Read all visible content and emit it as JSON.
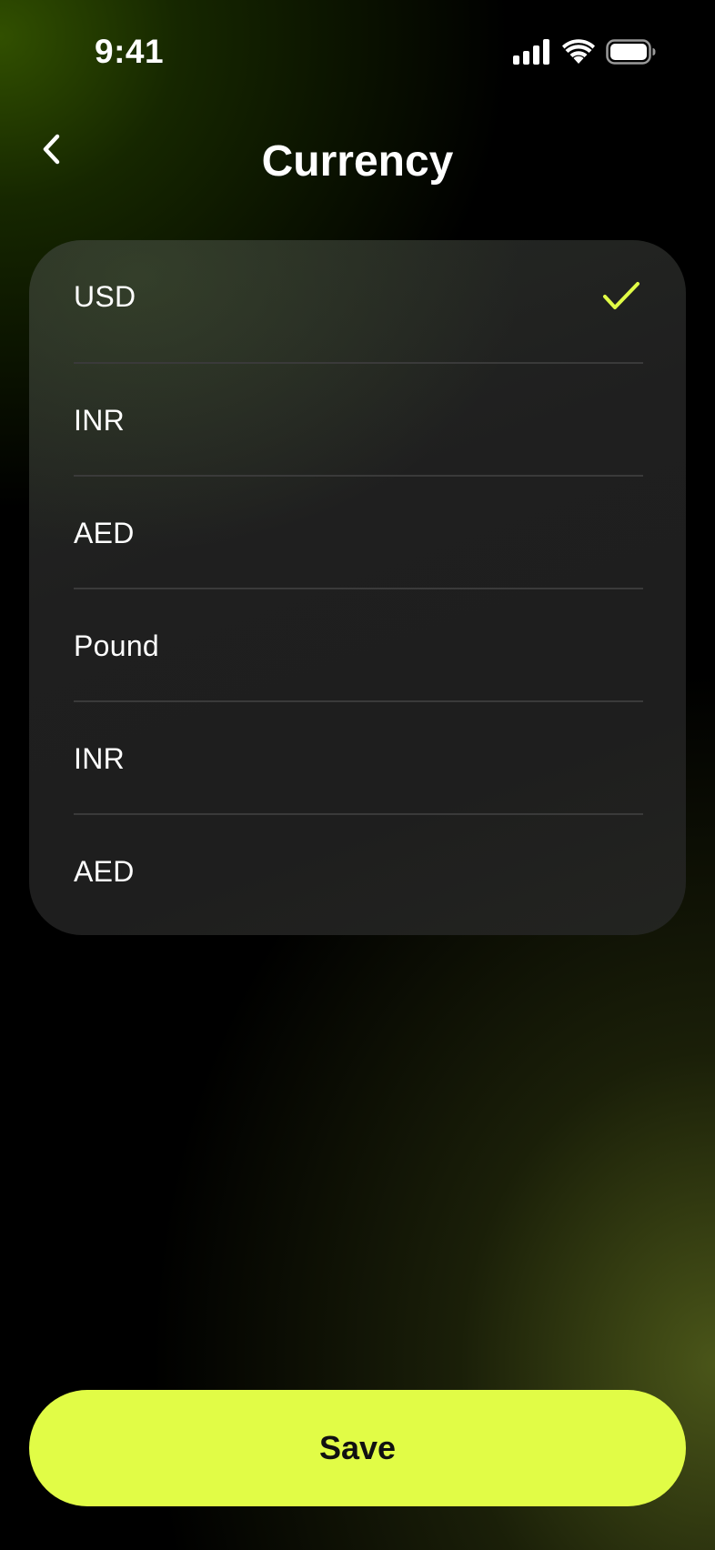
{
  "status_bar": {
    "time": "9:41",
    "icons": [
      "signal-icon",
      "wifi-icon",
      "battery-icon"
    ]
  },
  "header": {
    "back_icon": "chevron-left-icon",
    "title": "Currency"
  },
  "currency_list": {
    "items": [
      {
        "label": "USD",
        "selected": true
      },
      {
        "label": "INR",
        "selected": false
      },
      {
        "label": "AED",
        "selected": false
      },
      {
        "label": "Pound",
        "selected": false
      },
      {
        "label": "INR",
        "selected": false
      },
      {
        "label": "AED",
        "selected": false
      }
    ],
    "check_icon": "checkmark-icon"
  },
  "footer": {
    "save_label": "Save"
  },
  "colors": {
    "accent": "#e1fc46",
    "card_bg": "#1f1f1f",
    "divider": "#3a3a3a",
    "background": "#000000"
  }
}
